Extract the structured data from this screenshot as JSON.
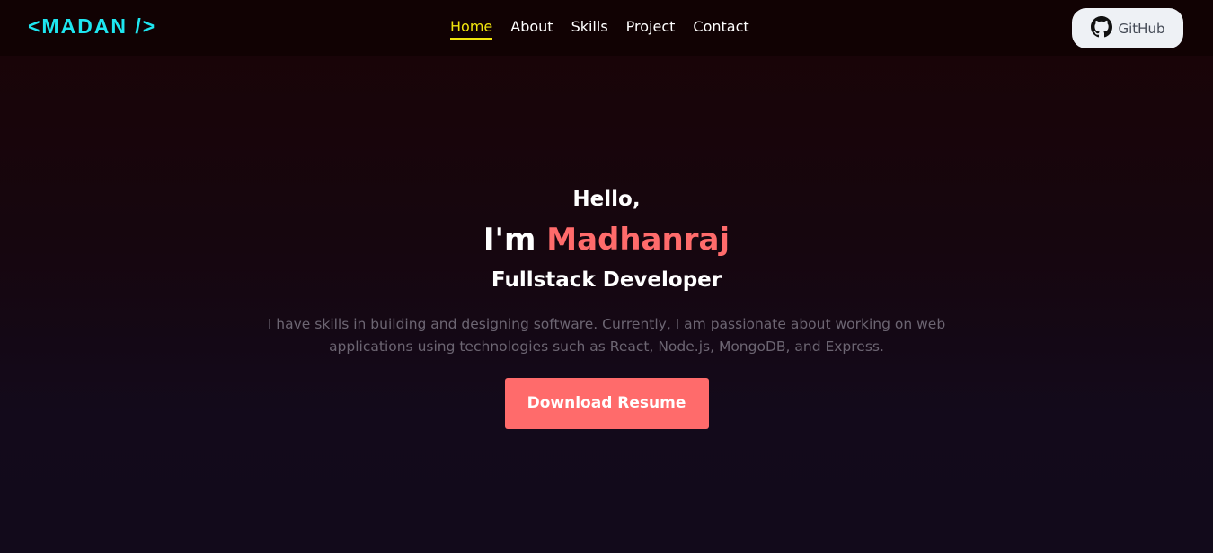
{
  "navbar": {
    "logo": "<MADAN />",
    "links": [
      {
        "label": "Home",
        "active": true
      },
      {
        "label": "About",
        "active": false
      },
      {
        "label": "Skills",
        "active": false
      },
      {
        "label": "Project",
        "active": false
      },
      {
        "label": "Contact",
        "active": false
      }
    ],
    "github_label": "GitHub",
    "github_icon": "github-icon"
  },
  "hero": {
    "greeting": "Hello,",
    "intro_prefix": "I'm ",
    "name": "Madhanraj",
    "role": "Fullstack Developer",
    "description": "I have skills in building and designing software. Currently, I am passionate about working on web applications using technologies such as React, Node.js, MongoDB, and Express.",
    "cta_label": "Download Resume"
  },
  "colors": {
    "logo": "#1ee6f0",
    "active_nav": "#f0e50d",
    "accent": "#ff6b6b",
    "github_button_bg": "#eef1f5"
  }
}
